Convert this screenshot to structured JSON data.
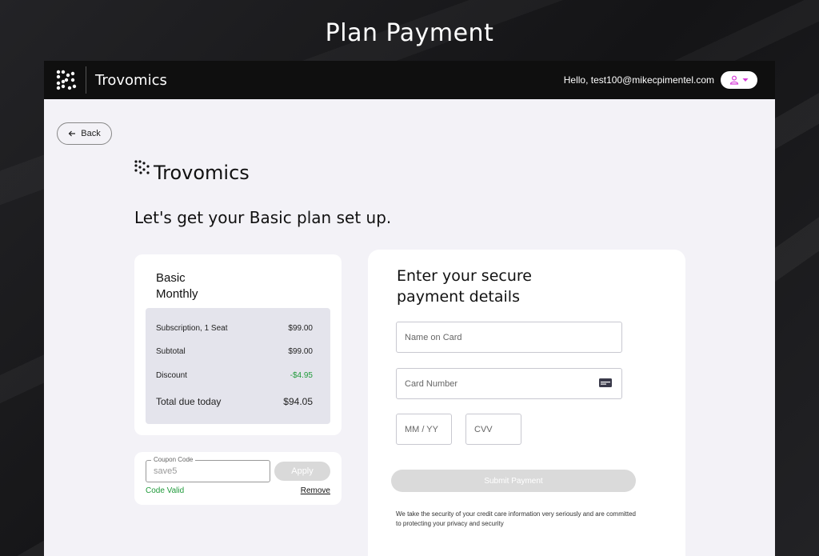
{
  "page": {
    "heading": "Plan Payment"
  },
  "topbar": {
    "brand": "Trovomics",
    "greeting": "Hello, test100@mikecpimentel.com",
    "user_icon": "user-icon",
    "accent_color": "#d63ad8"
  },
  "nav": {
    "back_label": "Back"
  },
  "content": {
    "brand": "Trovomics",
    "headline": "Let's get your Basic plan set up."
  },
  "summary": {
    "plan_name": "Basic",
    "plan_period": "Monthly",
    "rows": [
      {
        "label": "Subscription, 1 Seat",
        "value": "$99.00"
      },
      {
        "label": "Subtotal",
        "value": "$99.00"
      },
      {
        "label": "Discount",
        "value": "-$4.95"
      },
      {
        "label": "Total due today",
        "value": "$94.05"
      }
    ]
  },
  "coupon": {
    "label": "Coupon Code",
    "value": "save5",
    "apply_label": "Apply",
    "status": "Code Valid",
    "remove_label": "Remove"
  },
  "payment": {
    "title_line1": "Enter your secure",
    "title_line2": "payment details",
    "name_placeholder": "Name on Card",
    "card_placeholder": "Card Number",
    "expiry_placeholder": "MM / YY",
    "cvv_placeholder": "CVV",
    "submit_label": "Submit Payment",
    "security_note": "We take the security of your credit care information very seriously and are committed to protecting your privacy and security"
  }
}
